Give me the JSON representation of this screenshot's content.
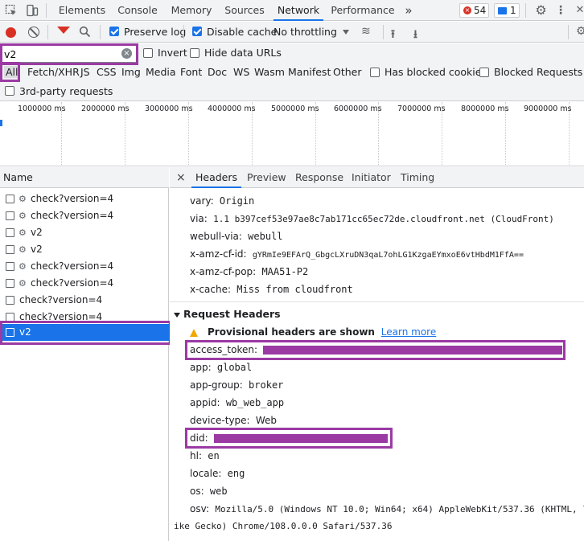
{
  "tabs": [
    "Elements",
    "Console",
    "Memory",
    "Sources",
    "Network",
    "Performance"
  ],
  "active_tab": "Network",
  "more_tabs": "»",
  "error_count": "54",
  "message_count": "1",
  "toolbar": {
    "preserve_log": "Preserve log",
    "disable_cache": "Disable cache",
    "throttling": "No throttling"
  },
  "filter": {
    "value": "v2",
    "invert": "Invert",
    "hide_data_urls": "Hide data URLs",
    "types": [
      "All",
      "Fetch/XHR",
      "JS",
      "CSS",
      "Img",
      "Media",
      "Font",
      "Doc",
      "WS",
      "Wasm",
      "Manifest",
      "Other"
    ],
    "has_blocked_cookies": "Has blocked cookies",
    "blocked_requests": "Blocked Requests",
    "third_party": "3rd-party requests"
  },
  "timeline_ticks": [
    "1000000 ms",
    "2000000 ms",
    "3000000 ms",
    "4000000 ms",
    "5000000 ms",
    "6000000 ms",
    "7000000 ms",
    "8000000 ms",
    "9000000 ms"
  ],
  "list": {
    "header": "Name",
    "requests": [
      {
        "name": "check?version=4",
        "icon": true
      },
      {
        "name": "check?version=4",
        "icon": true
      },
      {
        "name": "v2",
        "icon": true
      },
      {
        "name": "v2",
        "icon": true
      },
      {
        "name": "check?version=4",
        "icon": true
      },
      {
        "name": "check?version=4",
        "icon": true
      },
      {
        "name": "check?version=4",
        "icon": false
      },
      {
        "name": "check?version=4",
        "icon": false
      },
      {
        "name": "v2",
        "icon": false
      }
    ]
  },
  "detail": {
    "close": "×",
    "tabs": [
      "Headers",
      "Preview",
      "Response",
      "Initiator",
      "Timing"
    ],
    "response_headers": [
      {
        "k": "vary:",
        "v": "Origin"
      },
      {
        "k": "via:",
        "v": "1.1 b397cef53e97ae8c7ab171cc65ec72de.cloudfront.net (CloudFront)"
      },
      {
        "k": "webull-via:",
        "v": "webull"
      },
      {
        "k": "x-amz-cf-id:",
        "v": "gYRmIe9EFArQ_GbgcLXruDN3qaL7ohLG1KzgaEYmxoE6vtHbdM1FfA=="
      },
      {
        "k": "x-amz-cf-pop:",
        "v": "MAA51-P2"
      },
      {
        "k": "x-cache:",
        "v": "Miss from cloudfront"
      }
    ],
    "request_section": "Request Headers",
    "provisional": "Provisional headers are shown",
    "learn_more": "Learn more",
    "request_headers": [
      {
        "k": "access_token:",
        "v": ""
      },
      {
        "k": "app:",
        "v": "global"
      },
      {
        "k": "app-group:",
        "v": "broker"
      },
      {
        "k": "appid:",
        "v": "wb_web_app"
      },
      {
        "k": "device-type:",
        "v": "Web"
      },
      {
        "k": "did:",
        "v": ""
      },
      {
        "k": "hl:",
        "v": "en"
      },
      {
        "k": "locale:",
        "v": "eng"
      },
      {
        "k": "os:",
        "v": "web"
      },
      {
        "k": "osv:",
        "v": "Mozilla/5.0 (Windows NT 10.0; Win64; x64) AppleWebKit/537.36 (KHTML, l"
      }
    ],
    "osv_continuation": "ike Gecko) Chrome/108.0.0.0 Safari/537.36"
  },
  "colors": {
    "accent": "#1a73e8",
    "highlight": "#9b3aa3",
    "record": "#d93025"
  }
}
